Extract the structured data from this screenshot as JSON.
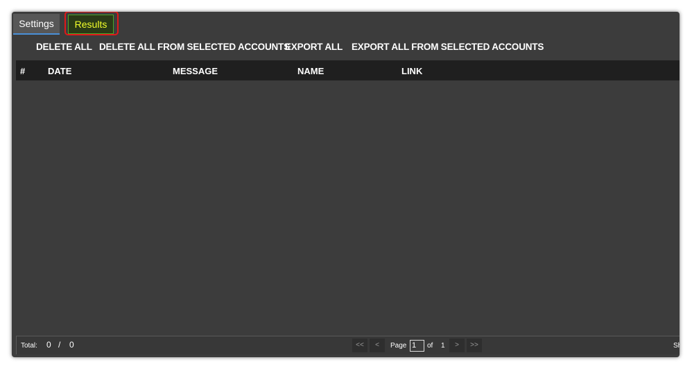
{
  "tabs": [
    {
      "label": "Settings"
    },
    {
      "label": "Results"
    }
  ],
  "toolbar": {
    "delete_all": "DELETE ALL",
    "delete_all_selected": "DELETE ALL FROM SELECTED ACCOUNTS",
    "export_all": "EXPORT ALL",
    "export_all_selected": "EXPORT ALL FROM SELECTED ACCOUNTS"
  },
  "grid": {
    "columns": [
      "#",
      "DATE",
      "MESSAGE",
      "NAME",
      "LINK"
    ],
    "rows": []
  },
  "status": {
    "total_label": "Total:",
    "total_count": "0",
    "total_separator": "/",
    "total_all": "0",
    "first_page": "<<",
    "prev_page": "<",
    "page_label": "Page",
    "page_value": "1",
    "of_label": "of",
    "page_count": "1",
    "next_page": ">",
    "last_page": ">>",
    "cut_text": "Sh"
  },
  "colors": {
    "background": "#3c3c3c",
    "header": "#1f1f1f",
    "active_tab_text": "#f2ff2a",
    "highlight": "#e11818",
    "selected_tab_underline": "#4a90d9"
  }
}
